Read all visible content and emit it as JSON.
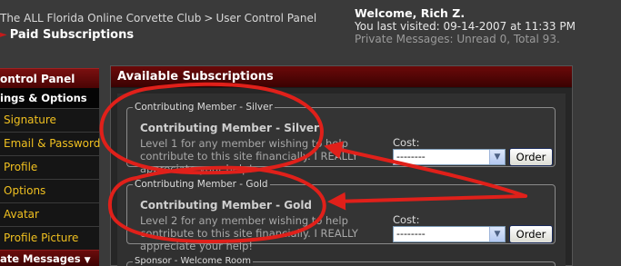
{
  "header": {
    "breadcrumb": {
      "site_link": "The ALL Florida Online Corvette Club",
      "separator": ">",
      "current": "User Control Panel"
    },
    "page_title": "Paid Subscriptions",
    "welcome": {
      "greeting": "Welcome, Rich Z.",
      "last_visited": "You last visited: 09-14-2007 at 11:33 PM",
      "private_messages": "Private Messages: Unread 0, Total 93."
    }
  },
  "sidebar": {
    "heading": "ontrol Panel",
    "section": "ings & Options",
    "items": [
      {
        "label": "Signature"
      },
      {
        "label": "Email & Password"
      },
      {
        "label": "Profile"
      },
      {
        "label": "Options"
      },
      {
        "label": "Avatar"
      },
      {
        "label": "Profile Picture"
      }
    ],
    "footer": "ate Messages"
  },
  "main": {
    "heading": "Available Subscriptions",
    "subscriptions": [
      {
        "legend": "Contributing Member - Silver",
        "title": "Contributing Member - Silver",
        "description": "Level 1 for any member wishing to help contribute to this site financially. I REALLY appreciate your help!",
        "cost_label": "Cost:",
        "cost_value": "--------",
        "order_label": "Order"
      },
      {
        "legend": "Contributing Member - Gold",
        "title": "Contributing Member - Gold",
        "description": "Level 2 for any member wishing to help contribute to this site financially. I REALLY appreciate your help!",
        "cost_label": "Cost:",
        "cost_value": "--------",
        "order_label": "Order"
      }
    ],
    "third_legend": "Sponsor - Welcome Room"
  },
  "annotation_color": "#e0201a",
  "icons": {
    "title_arrow": "red-arrow-icon",
    "dropdown": "chevron-down-icon",
    "messages_toggle": "triangle-down-icon"
  }
}
